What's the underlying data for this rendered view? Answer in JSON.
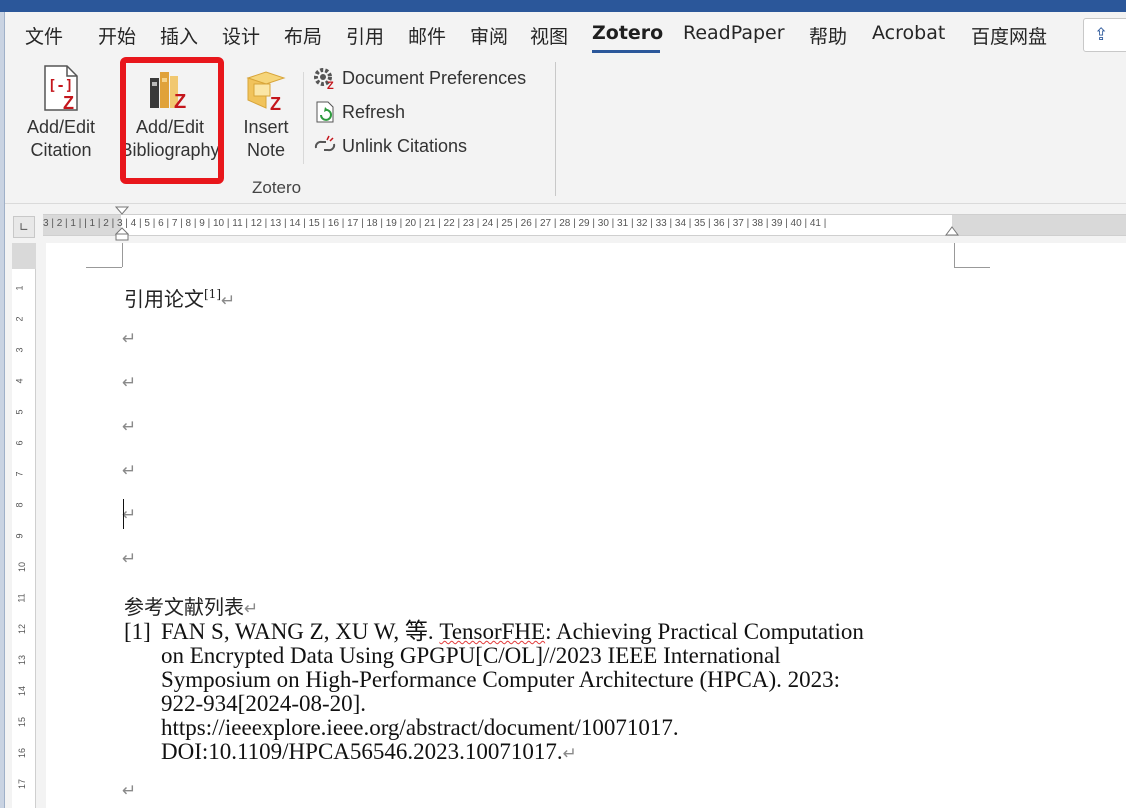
{
  "tabs": [
    {
      "label": "文件"
    },
    {
      "label": "开始"
    },
    {
      "label": "插入"
    },
    {
      "label": "设计"
    },
    {
      "label": "布局"
    },
    {
      "label": "引用"
    },
    {
      "label": "邮件"
    },
    {
      "label": "审阅"
    },
    {
      "label": "视图"
    },
    {
      "label": "Zotero",
      "active": true
    },
    {
      "label": "ReadPaper"
    },
    {
      "label": "帮助"
    },
    {
      "label": "Acrobat"
    },
    {
      "label": "百度网盘"
    }
  ],
  "ribbon": {
    "add_edit_citation": {
      "line1": "Add/Edit",
      "line2": "Citation"
    },
    "add_edit_bibliography": {
      "line1": "Add/Edit",
      "line2": "Bibliography"
    },
    "insert_note": {
      "line1": "Insert",
      "line2": "Note"
    },
    "document_preferences": "Document Preferences",
    "refresh": "Refresh",
    "unlink_citations": "Unlink Citations",
    "group_label": "Zotero"
  },
  "ruler": {
    "horizontal": "3 | 2 | 1 |   | 1 | 2 | 3 | 4 | 5 | 6 | 7 | 8 | 9 | 10 | 11 | 12 | 13 | 14 | 15 | 16 | 17 | 18 | 19 | 20 | 21 | 22 | 23 | 24 | 25 | 26 | 27 | 28 | 29 | 30 | 31 | 32 | 33 | 34 | 35 | 36 | 37 | 38 | 39 | 40 | 41 |",
    "vertical": [
      "1",
      "2",
      "3",
      "4",
      "5",
      "6",
      "7",
      "8",
      "9",
      "10",
      "11",
      "12",
      "13",
      "14",
      "15",
      "16",
      "17"
    ]
  },
  "document": {
    "heading": "引用论文",
    "citation_marker": "[1]",
    "paragraph_mark": "↵",
    "bibliography_title": "参考文献列表",
    "reference": {
      "number": "[1]",
      "line1_pre": "FAN S, WANG Z, XU W,  等. ",
      "line1_squiggle": "TensorFHE",
      "line1_post": ": Achieving Practical Computation",
      "line2": "on  Encrypted  Data  Using  GPGPU[C/OL]//2023  IEEE  International",
      "line3": "Symposium on High-Performance Computer Architecture (HPCA). 2023:",
      "line4": "922-934[2024-08-20].",
      "line5": "https://ieeexplore.ieee.org/abstract/document/10071017.",
      "line6": "DOI:10.1109/HPCA56546.2023.10071017."
    }
  },
  "colors": {
    "accent": "#2b579a",
    "highlight": "#e8161b",
    "zotero_red": "#c4161c"
  }
}
